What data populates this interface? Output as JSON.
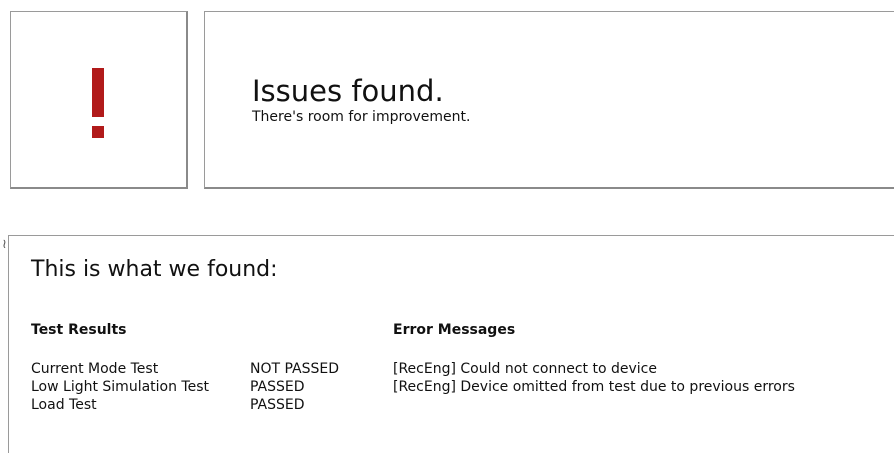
{
  "summary": {
    "title": "Issues found.",
    "subtitle": "There's room for improvement."
  },
  "icon": {
    "name": "exclamation-icon",
    "color": "#b11a1a"
  },
  "results": {
    "heading": "This is what we found:",
    "tests_title": "Test Results",
    "errors_title": "Error Messages",
    "tests": [
      {
        "name": "Current Mode Test",
        "status": "NOT PASSED"
      },
      {
        "name": "Low Light Simulation Test",
        "status": "PASSED"
      },
      {
        "name": "Load Test",
        "status": "PASSED"
      }
    ],
    "errors": [
      "[RecEng] Could not connect to device",
      "[RecEng] Device omitted from test due to previous errors"
    ]
  }
}
